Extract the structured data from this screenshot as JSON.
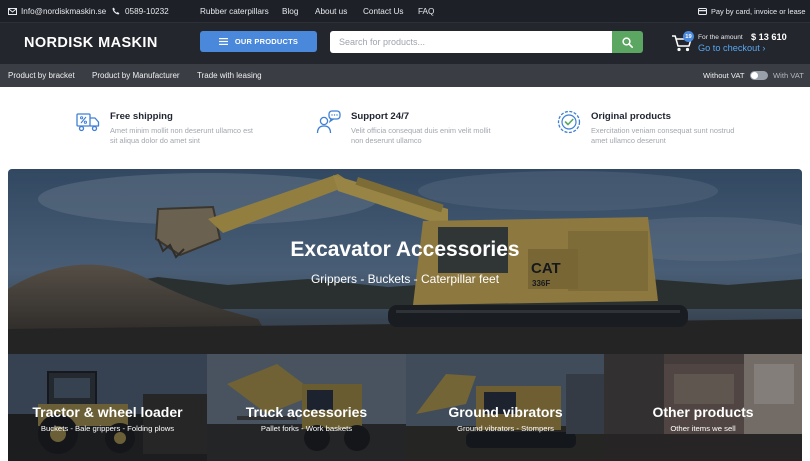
{
  "topbar": {
    "email": "Info@nordiskmaskin.se",
    "phone": "0589-10232",
    "links": [
      "Rubber caterpillars",
      "Blog",
      "About us",
      "Contact Us",
      "FAQ"
    ],
    "payment": "Pay by card, invoice or lease"
  },
  "header": {
    "logo": "NORDISK MASKIN",
    "products_button": "OUR PRODUCTS",
    "search_placeholder": "Search for products...",
    "cart_count": "19",
    "amount_label": "For the amount",
    "amount": "$ 13 610",
    "checkout": "Go to checkout ›"
  },
  "nav": {
    "items": [
      "Product by bracket",
      "Product by Manufacturer",
      "Trade with leasing"
    ],
    "vat_off": "Without VAT",
    "vat_on": "With VAT",
    "vat_enabled": false
  },
  "features": [
    {
      "icon": "truck-percent-icon",
      "title": "Free shipping",
      "desc": "Amet minim mollit non deserunt ullamco est sit aliqua dolor do amet sint"
    },
    {
      "icon": "support-chat-icon",
      "title": "Support 24/7",
      "desc": "Velit officia consequat duis enim velit mollit non deserunt ullamco"
    },
    {
      "icon": "quality-badge-icon",
      "title": "Original products",
      "desc": "Exercitation veniam consequat sunt nostrud amet ullamco deserunt"
    }
  ],
  "hero": {
    "title": "Excavator Accessories",
    "subtitle": "Grippers - Buckets - Caterpillar feet",
    "machine_text": [
      "CAT",
      "336F"
    ]
  },
  "categories": [
    {
      "title": "Tractor & wheel loader",
      "subtitle": "Buckets - Bale grippers - Folding plows"
    },
    {
      "title": "Truck accessories",
      "subtitle": "Pallet forks - Work baskets"
    },
    {
      "title": "Ground vibrators",
      "subtitle": "Ground vibrators - Stompers"
    },
    {
      "title": "Other products",
      "subtitle": "Other items we sell"
    }
  ],
  "colors": {
    "accent_blue": "#4a88db",
    "search_green": "#5ba661",
    "checkout_link": "#58a6f0",
    "dark_bar": "#1d2027"
  }
}
